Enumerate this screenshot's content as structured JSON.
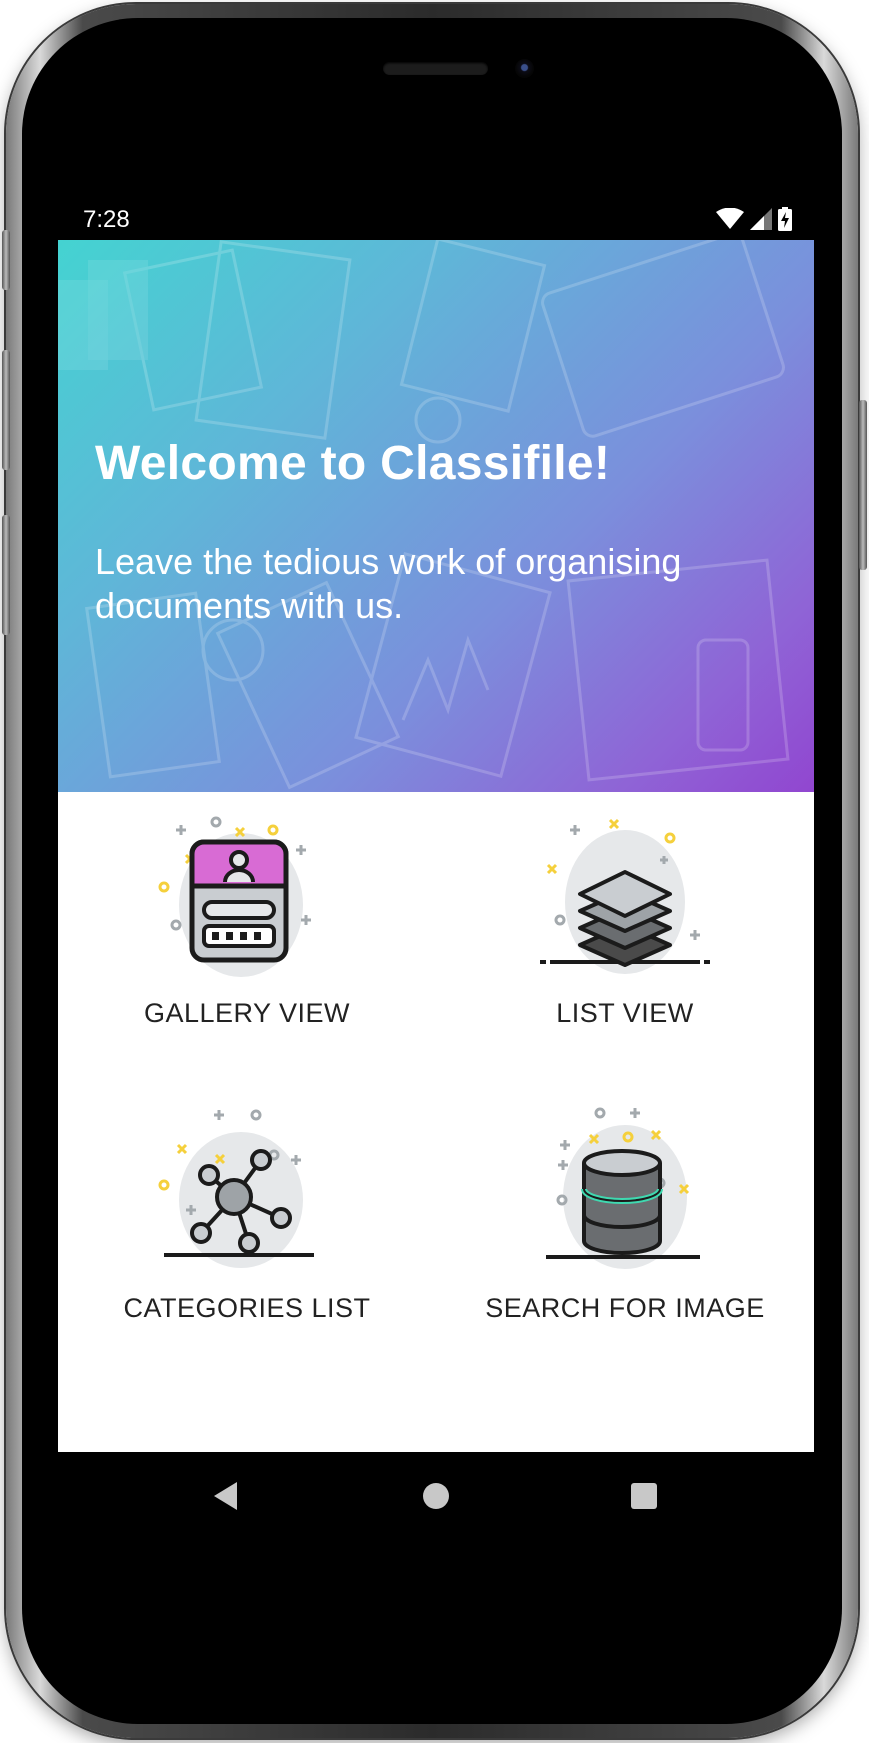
{
  "status_bar": {
    "time": "7:28",
    "icons": [
      "wifi-icon",
      "cellular-signal-icon",
      "battery-charging-icon"
    ]
  },
  "hero": {
    "title": "Welcome to Classifile!",
    "subtitle": "Leave the tedious work of organising documents with us.",
    "gradient_colors": [
      "#44d3d1",
      "#7b8fdc",
      "#9146d0"
    ]
  },
  "menu": {
    "items": [
      {
        "label": "GALLERY VIEW",
        "icon": "id-card-icon"
      },
      {
        "label": "LIST VIEW",
        "icon": "layers-icon"
      },
      {
        "label": "CATEGORIES LIST",
        "icon": "network-icon"
      },
      {
        "label": "SEARCH FOR IMAGE",
        "icon": "database-icon"
      }
    ]
  },
  "nav_bar": {
    "buttons": [
      "back-icon",
      "home-icon",
      "recents-icon"
    ]
  },
  "colors": {
    "accent_pink": "#d86bd4",
    "accent_teal": "#3fd9b0",
    "accent_yellow": "#f5d03c",
    "icon_gray": "#a3a9ad",
    "label_text": "#222222"
  }
}
